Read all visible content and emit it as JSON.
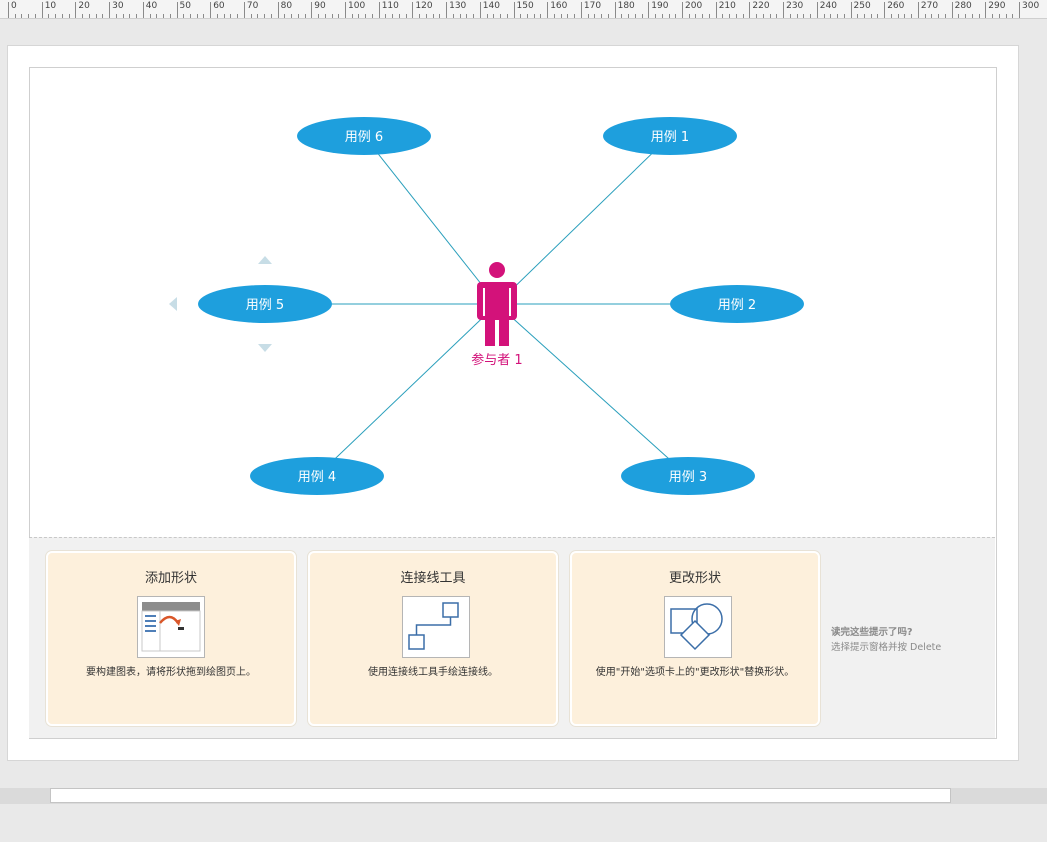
{
  "ruler": {
    "labels": [
      "0",
      "10",
      "20",
      "30",
      "40",
      "50",
      "60",
      "70",
      "80",
      "90",
      "100",
      "110",
      "120",
      "130",
      "140",
      "150",
      "160",
      "170",
      "180",
      "190",
      "200",
      "210",
      "220",
      "230",
      "240",
      "250",
      "260",
      "270",
      "280",
      "290",
      "300"
    ]
  },
  "diagram": {
    "actor": {
      "label": "参与者 1",
      "color": "#d3127a"
    },
    "use_cases": [
      {
        "label": "用例 6"
      },
      {
        "label": "用例 1"
      },
      {
        "label": "用例 5"
      },
      {
        "label": "用例 2"
      },
      {
        "label": "用例 4"
      },
      {
        "label": "用例 3"
      }
    ],
    "colors": {
      "ellipse": "#1e9fdd",
      "connector": "#2a9fbc",
      "handle": "#c7dde6"
    }
  },
  "tips": {
    "cards": [
      {
        "title": "添加形状",
        "text": "要构建图表，请将形状拖到绘图页上。"
      },
      {
        "title": "连接线工具",
        "text": "使用连接线工具手绘连接线。"
      },
      {
        "title": "更改形状",
        "text": "使用\"开始\"选项卡上的\"更改形状\"替换形状。"
      }
    ],
    "question": "读完这些提示了吗?",
    "hint": "选择提示窗格并按 Delete"
  }
}
